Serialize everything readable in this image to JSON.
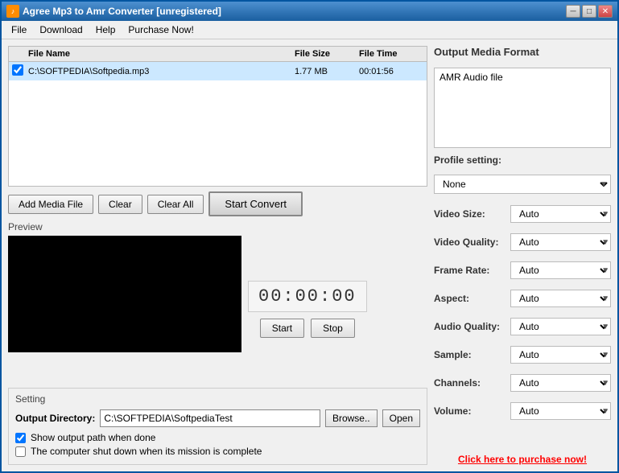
{
  "window": {
    "title": "Agree Mp3 to Amr Converter [unregistered]",
    "icon": "♪"
  },
  "titleButtons": {
    "minimize": "─",
    "maximize": "□",
    "close": "✕"
  },
  "menu": {
    "items": [
      "File",
      "Download",
      "Help",
      "Purchase Now!"
    ]
  },
  "fileTable": {
    "columns": [
      "",
      "File Name",
      "File Size",
      "File Time"
    ],
    "rows": [
      {
        "checked": true,
        "name": "C:\\SOFTPEDIA\\Softpedia.mp3",
        "size": "1.77 MB",
        "time": "00:01:56"
      }
    ]
  },
  "buttons": {
    "addMediaFile": "Add Media File",
    "clear": "Clear",
    "clearAll": "Clear All",
    "startConvert": "Start Convert",
    "start": "Start",
    "stop": "Stop",
    "browse": "Browse..",
    "open": "Open"
  },
  "preview": {
    "label": "Preview",
    "timeDisplay": "00:00:00"
  },
  "setting": {
    "label": "Setting",
    "outputDirLabel": "Output Directory:",
    "outputDirValue": "C:\\SOFTPEDIA\\SoftpediaTest",
    "checkboxes": {
      "showOutputPath": "Show output path when done",
      "shutdownWhenDone": "The computer shut down when its mission is complete"
    }
  },
  "rightPanel": {
    "outputMediaFormat": {
      "title": "Output Media Format",
      "value": "AMR Audio file"
    },
    "profileSetting": {
      "title": "Profile setting:",
      "options": [
        "None"
      ],
      "selected": "None"
    },
    "videoSize": {
      "label": "Video Size:",
      "options": [
        "Auto"
      ],
      "selected": "Auto"
    },
    "videoQuality": {
      "label": "Video Quality:",
      "options": [
        "Auto"
      ],
      "selected": "Auto"
    },
    "frameRate": {
      "label": "Frame Rate:",
      "options": [
        "Auto"
      ],
      "selected": "Auto"
    },
    "aspect": {
      "label": "Aspect:",
      "options": [
        "Auto"
      ],
      "selected": "Auto"
    },
    "audioQuality": {
      "label": "Audio Quality:",
      "options": [
        "Auto"
      ],
      "selected": "Auto"
    },
    "sample": {
      "label": "Sample:",
      "options": [
        "Auto"
      ],
      "selected": "Auto"
    },
    "channels": {
      "label": "Channels:",
      "options": [
        "Auto"
      ],
      "selected": "Auto"
    },
    "volume": {
      "label": "Volume:",
      "options": [
        "Auto"
      ],
      "selected": "Auto"
    },
    "purchaseLink": "Click here to purchase now!"
  }
}
